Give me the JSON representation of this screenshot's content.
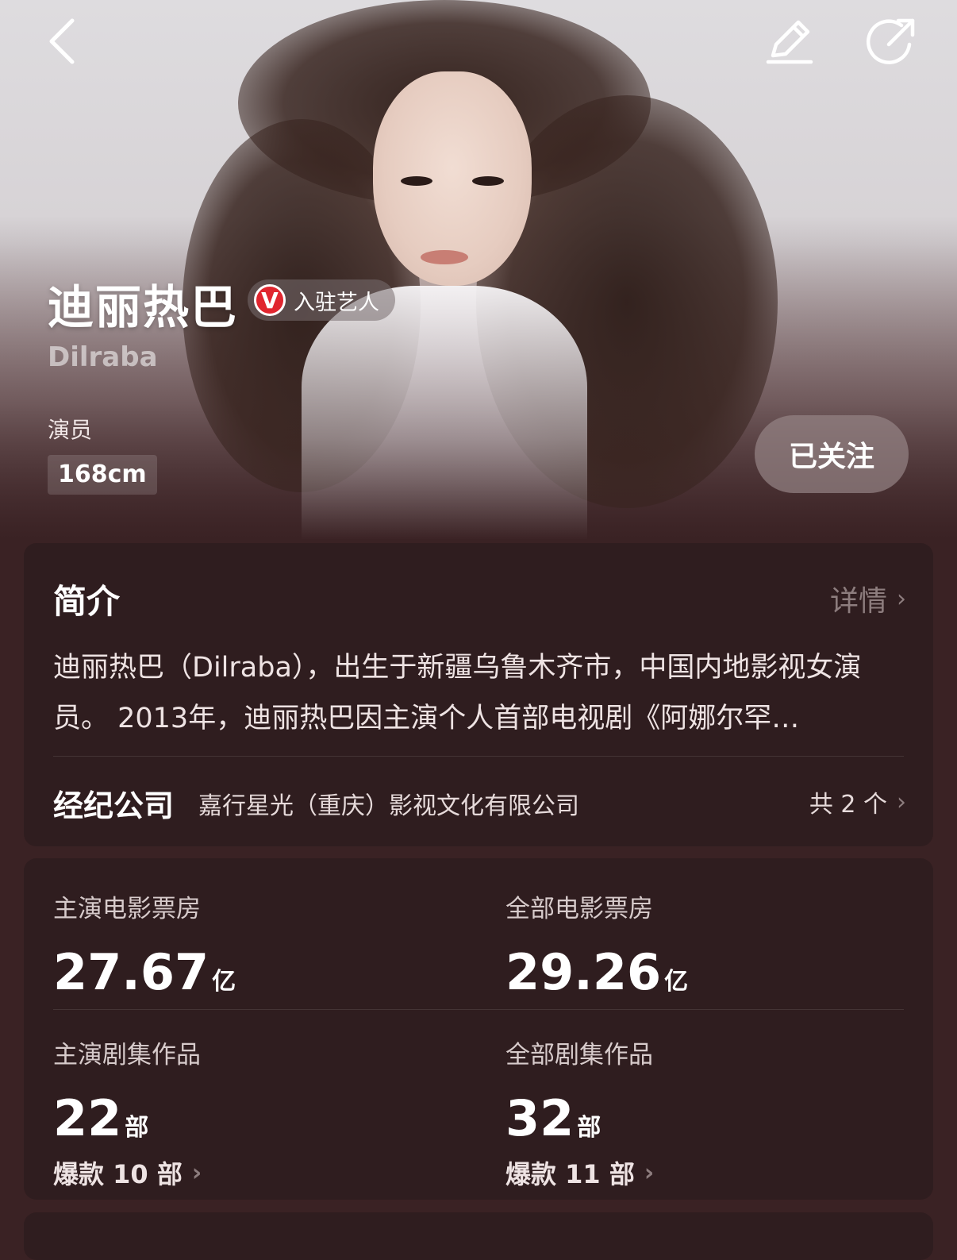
{
  "header": {
    "back_icon": "chevron-left-icon",
    "edit_icon": "pencil-icon",
    "share_icon": "share-icon"
  },
  "profile": {
    "name": "迪丽热巴",
    "verified_label": "入驻艺人",
    "verified_badge": "V",
    "english_name": "Dilraba",
    "role": "演员",
    "height": "168cm",
    "follow_label": "已关注"
  },
  "intro": {
    "title": "简介",
    "detail_label": "详情",
    "text": "迪丽热巴（Dilraba），出生于新疆乌鲁木齐市，中国内地影视女演员。 2013年，迪丽热巴因主演个人首部电视剧《阿娜尔罕…",
    "agency_label": "经纪公司",
    "agency_name": "嘉行星光（重庆）影视文化有限公司",
    "agency_count": "共 2 个"
  },
  "stats": [
    {
      "label": "主演电影票房",
      "value": "27.67",
      "unit": "亿"
    },
    {
      "label": "全部电影票房",
      "value": "29.26",
      "unit": "亿"
    },
    {
      "label": "主演剧集作品",
      "value": "22",
      "unit": "部",
      "hit": "爆款 10 部"
    },
    {
      "label": "全部剧集作品",
      "value": "32",
      "unit": "部",
      "hit": "爆款 11 部"
    }
  ],
  "colors": {
    "background": "#3a2224",
    "card": "#2f1d1f",
    "badge_red": "#e0262f"
  }
}
